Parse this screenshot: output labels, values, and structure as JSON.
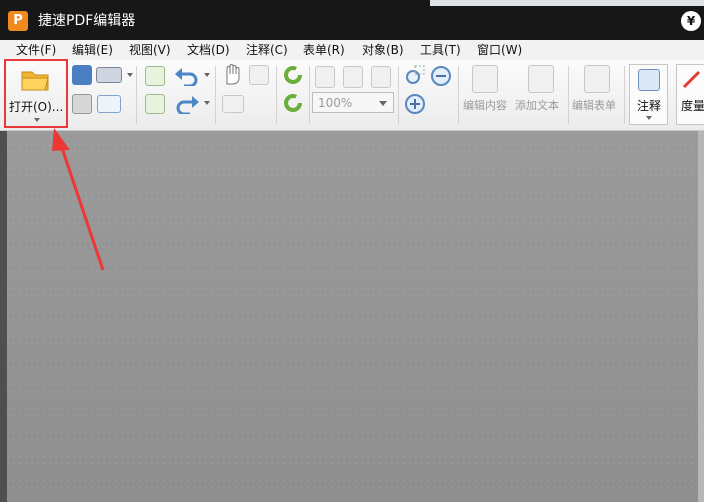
{
  "app": {
    "logo_letter": "P",
    "title": "捷速PDF编辑器",
    "title_right_symbol": "¥"
  },
  "menu": [
    {
      "label": "文件(F)"
    },
    {
      "label": "编辑(E)"
    },
    {
      "label": "视图(V)"
    },
    {
      "label": "文档(D)"
    },
    {
      "label": "注释(C)"
    },
    {
      "label": "表单(R)"
    },
    {
      "label": "对象(B)"
    },
    {
      "label": "工具(T)"
    },
    {
      "label": "窗口(W)"
    }
  ],
  "toolbar": {
    "open_label": "打开(O)...",
    "zoom_value": "100%",
    "edit_content": "编辑内容",
    "add_text": "添加文本",
    "edit_form": "编辑表单",
    "annotate": "注释",
    "measure": "度量"
  },
  "colors": {
    "highlight": "#e83a3a",
    "titlebar": "#171717",
    "app_logo": "#f08a1e"
  }
}
